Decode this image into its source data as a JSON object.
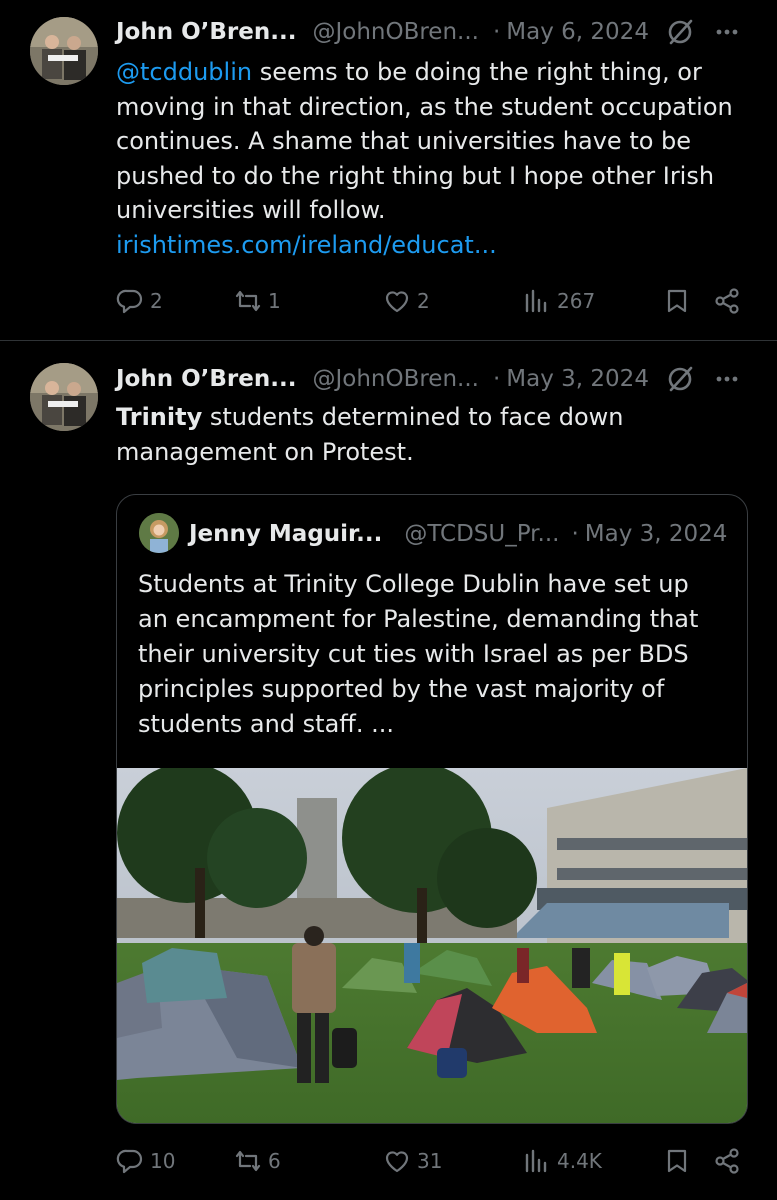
{
  "tweets": [
    {
      "author_name": "John O’Bren...",
      "author_handle": "@JohnOBren...",
      "separator": "·",
      "date": "May 6, 2024",
      "mention": "@tcddublin",
      "text": " seems to be doing the right thing, or moving in that direction, as the student occupation continues. A shame that universities have to be pushed to do the right thing but I hope other Irish universities will follow.",
      "link": "irishtimes.com/ireland/educat...",
      "replies": "2",
      "reposts": "1",
      "likes": "2",
      "views": "267"
    },
    {
      "author_name": "John O’Bren...",
      "author_handle": "@JohnOBren...",
      "separator": "·",
      "date": "May 3, 2024",
      "text_bold": "Trinity",
      "text": " students determined to face down management on Protest.",
      "quote": {
        "author_name": "Jenny Maguir...",
        "author_handle": "@TCDSU_Pr...",
        "separator": "·",
        "date": "May 3, 2024",
        "text": "Students at Trinity College Dublin have set up an encampment for Palestine, demanding that their university cut ties with Israel as per BDS principles supported by the vast majority of students and staff.  ..."
      },
      "replies": "10",
      "reposts": "6",
      "likes": "31",
      "views": "4.4K"
    }
  ],
  "icons": {
    "reply": "reply-icon",
    "repost": "repost-icon",
    "like": "heart-icon",
    "views": "views-icon",
    "bookmark": "bookmark-icon",
    "share": "share-icon",
    "grok": "grok-icon",
    "more": "more-icon"
  },
  "colors": {
    "background": "#000000",
    "text": "#e7e9ea",
    "muted": "#71767b",
    "link": "#1d9bf0",
    "border": "#2f3336"
  }
}
